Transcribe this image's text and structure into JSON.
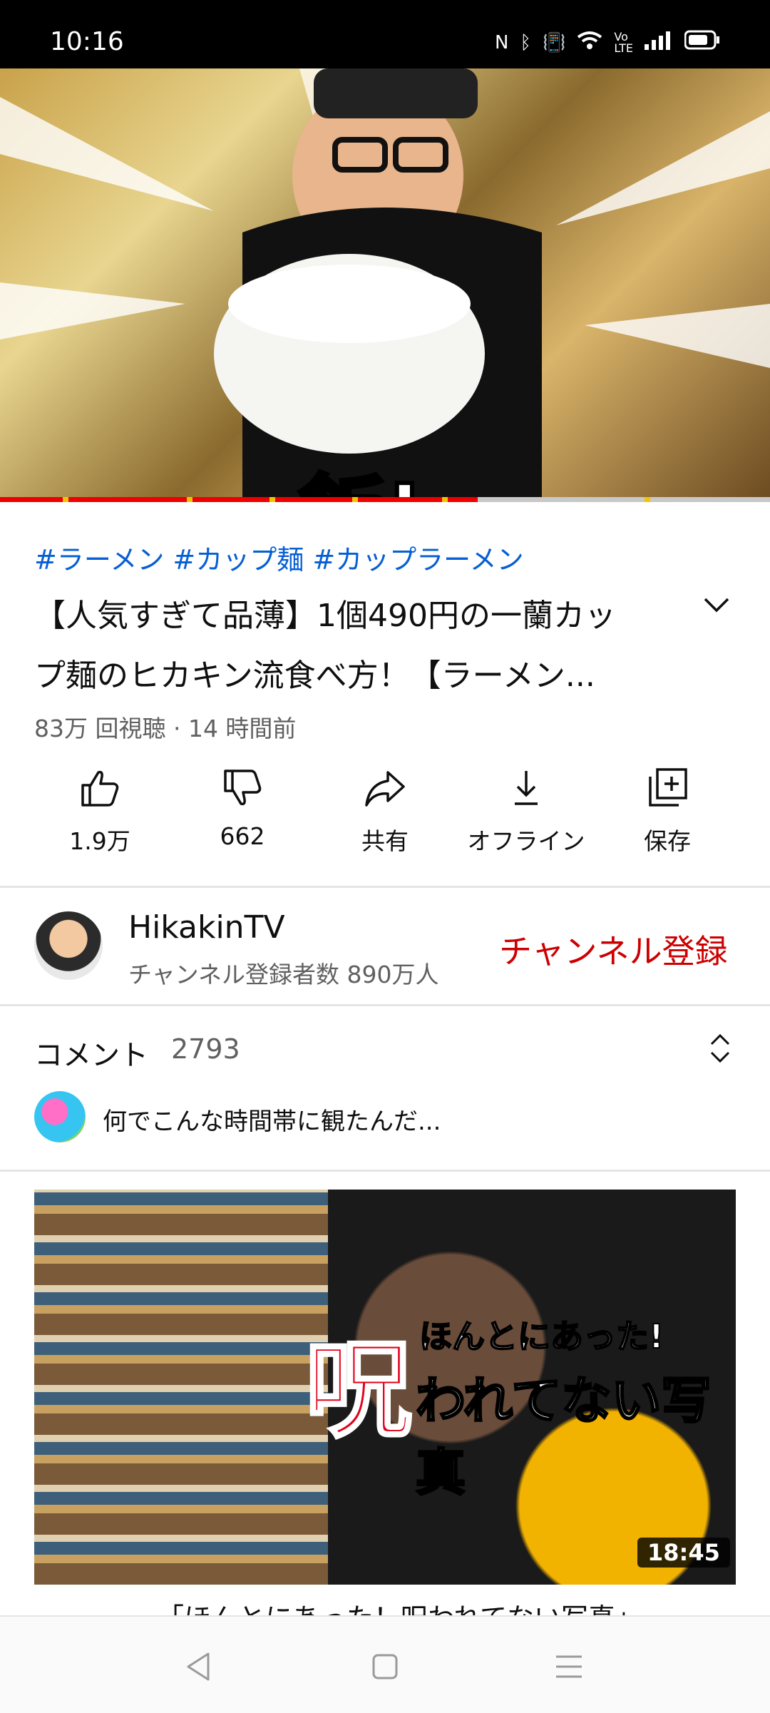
{
  "status_bar": {
    "time": "10:16",
    "icons": [
      "nfc-icon",
      "bluetooth-icon",
      "vibrate-icon",
      "wifi-icon",
      "volte-icon",
      "signal-icon",
      "battery-icon"
    ]
  },
  "video": {
    "overlay_text": "飯!",
    "progress": 0.62
  },
  "info": {
    "hashtags": "#ラーメン #カップ麺 #カップラーメン",
    "title_line1": "【人気すぎて品薄】1個490円の一蘭カッ",
    "title_line2": "プ麺のヒカキン流食べ方！【ラーメン...",
    "meta": "83万 回視聴 · 14 時間前"
  },
  "actions": [
    {
      "label": "1.9万",
      "icon": "thumbs-up-icon"
    },
    {
      "label": "662",
      "icon": "thumbs-down-icon"
    },
    {
      "label": "共有",
      "icon": "share-icon"
    },
    {
      "label": "オフライン",
      "icon": "download-icon"
    },
    {
      "label": "保存",
      "icon": "add-to-playlist-icon"
    }
  ],
  "channel": {
    "name": "HikakinTV",
    "subscribers": "チャンネル登録者数 890万人",
    "subscribe_label": "チャンネル登録"
  },
  "comments": {
    "label": "コメント",
    "count": "2793",
    "preview": "何でこんな時間帯に観たんだ..."
  },
  "next_video": {
    "thumb_curse": "呪",
    "thumb_line1": "ほんとにあった!",
    "thumb_line2": "われてない写真",
    "duration": "18:45",
    "title": "「ほんとにあった！呪われてない写真」"
  },
  "colors": {
    "accent_red": "#cc0000",
    "link_blue": "#065fd4"
  }
}
